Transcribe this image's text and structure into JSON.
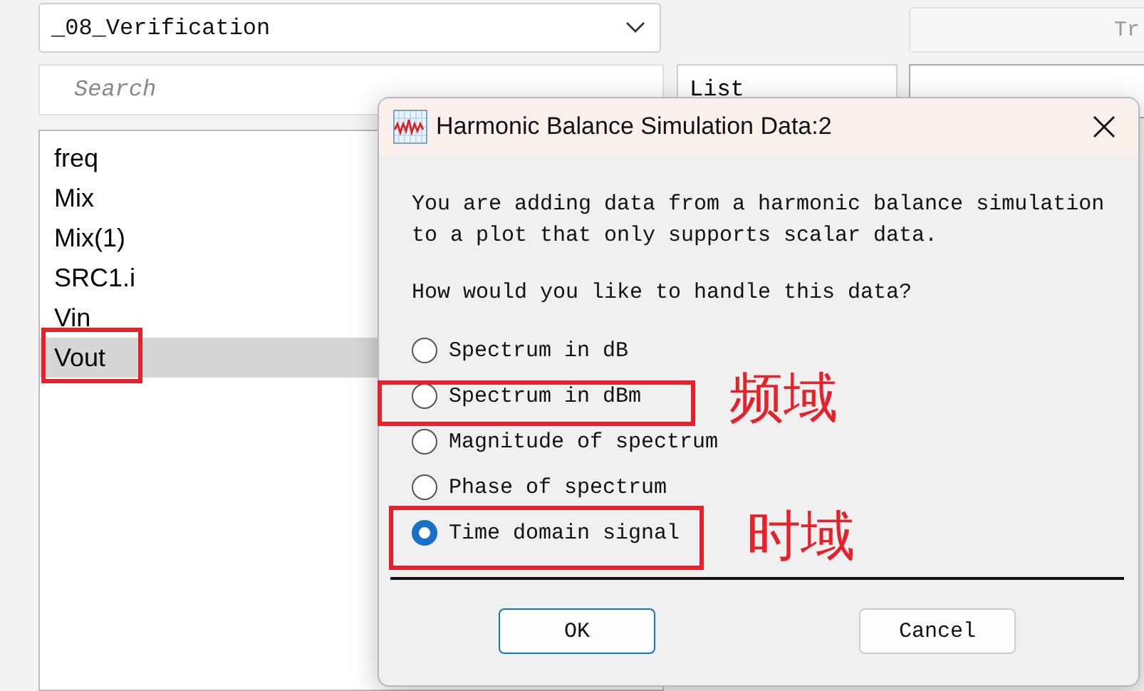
{
  "background": {
    "project_dropdown": "_08_Verification",
    "top_right_field": "Tr",
    "search": {
      "placeholder": "Search"
    },
    "view_dropdown": "List",
    "variables": [
      {
        "label": "freq",
        "selected": false
      },
      {
        "label": "Mix",
        "selected": false
      },
      {
        "label": "Mix(1)",
        "selected": false
      },
      {
        "label": "SRC1.i",
        "selected": false
      },
      {
        "label": "Vin",
        "selected": false
      },
      {
        "label": "Vout",
        "selected": true
      }
    ]
  },
  "dialog": {
    "title": "Harmonic Balance Simulation Data:2",
    "message": "You are adding data from a harmonic balance simulation to a plot that only supports scalar data.",
    "question": "How would you like to handle this data?",
    "options": [
      {
        "label": "Spectrum in dB",
        "selected": false
      },
      {
        "label": "Spectrum in dBm",
        "selected": false
      },
      {
        "label": "Magnitude of spectrum",
        "selected": false
      },
      {
        "label": "Phase of spectrum",
        "selected": false
      },
      {
        "label": "Time domain signal",
        "selected": true
      }
    ],
    "buttons": [
      {
        "label": "OK",
        "default": true
      },
      {
        "label": "Cancel",
        "default": false
      }
    ]
  },
  "annotations": [
    "频域",
    "时域"
  ]
}
